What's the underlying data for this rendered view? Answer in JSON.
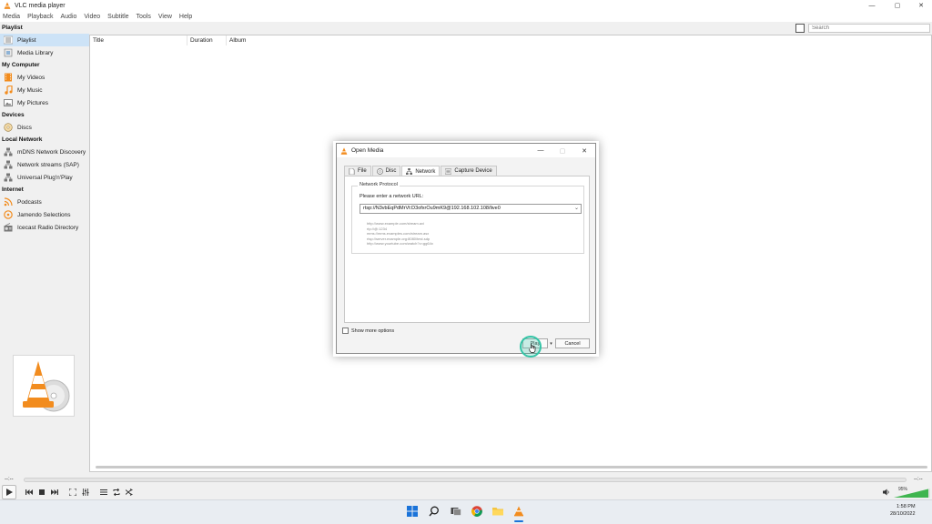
{
  "window": {
    "title": "VLC media player",
    "minimize": "—",
    "maximize": "▢",
    "close": "✕"
  },
  "menubar": [
    "Media",
    "Playback",
    "Audio",
    "Video",
    "Subtitle",
    "Tools",
    "View",
    "Help"
  ],
  "sidebar": {
    "sections": [
      {
        "title": "Playlist",
        "items": [
          {
            "label": "Playlist",
            "icon": "playlist-icon",
            "selected": true
          },
          {
            "label": "Media Library",
            "icon": "media-library-icon"
          }
        ]
      },
      {
        "title": "My Computer",
        "items": [
          {
            "label": "My Videos",
            "icon": "videos-icon"
          },
          {
            "label": "My Music",
            "icon": "music-icon"
          },
          {
            "label": "My Pictures",
            "icon": "pictures-icon"
          }
        ]
      },
      {
        "title": "Devices",
        "items": [
          {
            "label": "Discs",
            "icon": "disc-icon"
          }
        ]
      },
      {
        "title": "Local Network",
        "items": [
          {
            "label": "mDNS Network Discovery",
            "icon": "network-icon"
          },
          {
            "label": "Network streams (SAP)",
            "icon": "network-icon"
          },
          {
            "label": "Universal Plug'n'Play",
            "icon": "network-icon"
          }
        ]
      },
      {
        "title": "Internet",
        "items": [
          {
            "label": "Podcasts",
            "icon": "podcast-icon"
          },
          {
            "label": "Jamendo Selections",
            "icon": "jamendo-icon"
          },
          {
            "label": "Icecast Radio Directory",
            "icon": "radio-icon"
          }
        ]
      }
    ]
  },
  "playlist": {
    "search_placeholder": "Search",
    "columns": [
      "Title",
      "Duration",
      "Album"
    ]
  },
  "player": {
    "elapsed": "--:--",
    "remaining": "--:--",
    "volume": "95%"
  },
  "taskbar": {
    "time": "1:58 PM",
    "date": "28/10/2022"
  },
  "dialog": {
    "title": "Open Media",
    "tabs": [
      {
        "label": "File",
        "icon": "file-icon"
      },
      {
        "label": "Disc",
        "icon": "disc-icon"
      },
      {
        "label": "Network",
        "icon": "network-icon",
        "active": true
      },
      {
        "label": "Capture Device",
        "icon": "capture-device-icon"
      }
    ],
    "group_title": "Network Protocol",
    "url_label": "Please enter a network URL:",
    "url_value": "rtsp://N3vbEqPdMrVt:D3ofxrOu9mK9@192.168.102.108/live0",
    "examples": [
      "http://www.example.com/stream.avi",
      "rtp://@:1234",
      "mms://mms.examples.com/stream.asx",
      "rtsp://server.example.org:8080/test.sdp",
      "http://www.yourtube.com/watch?v=gg64x"
    ],
    "show_more_options": "Show more options",
    "play_label": "Play",
    "cancel_label": "Cancel"
  },
  "colors": {
    "selection": "#cde3f7",
    "vlc_orange": "#f28c1e",
    "cursor_highlight": "#34c4a6",
    "taskbar": "#e9edf2"
  }
}
